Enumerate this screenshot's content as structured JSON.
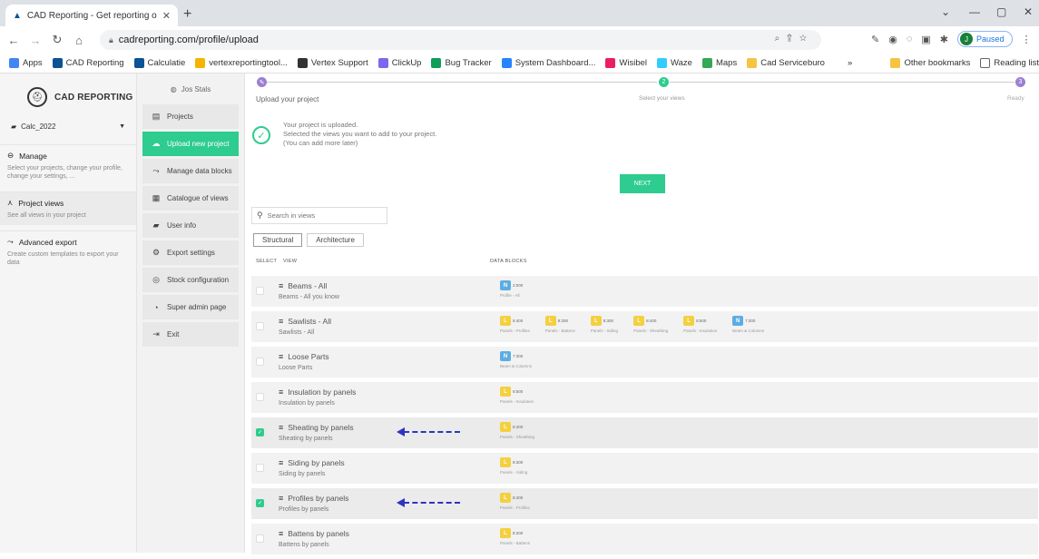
{
  "browser": {
    "tab_title": "CAD Reporting - Get reporting o",
    "url": "cadreporting.com/profile/upload",
    "paused_label": "Paused",
    "profile_initial": "J",
    "bookmarks": [
      {
        "label": "Apps",
        "color": "#4285f4"
      },
      {
        "label": "CAD Reporting",
        "color": "#0b5394"
      },
      {
        "label": "Calculatie",
        "color": "#0b5394"
      },
      {
        "label": "vertexreportingtool...",
        "color": "#f4b400"
      },
      {
        "label": "Vertex Support",
        "color": "#333333"
      },
      {
        "label": "ClickUp",
        "color": "#7b68ee"
      },
      {
        "label": "Bug Tracker",
        "color": "#0f9d58"
      },
      {
        "label": "System Dashboard...",
        "color": "#2684ff"
      },
      {
        "label": "Wisibel",
        "color": "#e91e63"
      },
      {
        "label": "Waze",
        "color": "#33ccff"
      },
      {
        "label": "Maps",
        "color": "#34a853"
      },
      {
        "label": "Cad Serviceburo",
        "color": "#f6c343"
      }
    ],
    "more_bookmarks": "»",
    "other_bookmarks": "Other bookmarks",
    "reading_list": "Reading list"
  },
  "app": {
    "logo": "CAD REPORTING",
    "project": "Calc_2022",
    "sections": [
      {
        "title": "Manage",
        "desc": "Select your projects, change your profile, change your settings, ..."
      },
      {
        "title": "Project views",
        "desc": "See all views in your project"
      },
      {
        "title": "Advanced export",
        "desc": "Create custom templates to export your data"
      }
    ],
    "user": "Jos Stals",
    "menu": [
      {
        "label": "Projects",
        "icon": "▤"
      },
      {
        "label": "Upload new project",
        "icon": "☁"
      },
      {
        "label": "Manage data blocks",
        "icon": "⤳"
      },
      {
        "label": "Catalogue of views",
        "icon": "▦"
      },
      {
        "label": "User info",
        "icon": "▰"
      },
      {
        "label": "Export settings",
        "icon": "⚙"
      },
      {
        "label": "Stock configuration",
        "icon": "◎"
      },
      {
        "label": "Super admin page",
        "icon": "◔"
      },
      {
        "label": "Exit",
        "icon": "⇥"
      }
    ]
  },
  "steps": [
    {
      "label": "Upload your project",
      "mark": "✎"
    },
    {
      "label": "Select your views",
      "mark": "2"
    },
    {
      "label": "Ready",
      "mark": "3"
    }
  ],
  "upload_message": {
    "line1": "Your project is uploaded.",
    "line2": "Selected the views you want to add to your project.",
    "line3": "(You can add more later)"
  },
  "next_label": "NEXT",
  "search_placeholder": "Search in views",
  "view_tabs": [
    "Structural",
    "Architecture"
  ],
  "columns": {
    "select": "SELECT",
    "view": "VIEW",
    "data_blocks": "DATA BLOCKS"
  },
  "colors": {
    "accent": "#2ecc8e",
    "arrow": "#2b35c4"
  },
  "views": [
    {
      "name": "Beams - All",
      "sub": "Beams - All you know",
      "checked": false,
      "blocks": [
        {
          "t": "b",
          "n": "2:000",
          "l": "Profile - All"
        }
      ]
    },
    {
      "name": "Sawlists - All",
      "sub": "Sawlists - All",
      "checked": false,
      "blocks": [
        {
          "t": "y",
          "n": "8:400",
          "l": "Panels - Profiles"
        },
        {
          "t": "y",
          "n": "8:200",
          "l": "Panels - Battens"
        },
        {
          "t": "y",
          "n": "8:300",
          "l": "Panels - Siding"
        },
        {
          "t": "y",
          "n": "8:400",
          "l": "Panels - Sheathing"
        },
        {
          "t": "y",
          "n": "8:500",
          "l": "Panels - Insulation"
        },
        {
          "t": "b",
          "n": "7:300",
          "l": "Beam & Columns"
        }
      ]
    },
    {
      "name": "Loose Parts",
      "sub": "Loose Parts",
      "checked": false,
      "blocks": [
        {
          "t": "b",
          "n": "7:300",
          "l": "Beam & Columns"
        }
      ]
    },
    {
      "name": "Insulation by panels",
      "sub": "Insulation by panels",
      "checked": false,
      "blocks": [
        {
          "t": "y",
          "n": "8:500",
          "l": "Panels - Insulation"
        }
      ]
    },
    {
      "name": "Sheating by panels",
      "sub": "Sheating by panels",
      "checked": true,
      "blocks": [
        {
          "t": "y",
          "n": "8:400",
          "l": "Panels - Sheathing"
        }
      ]
    },
    {
      "name": "Siding by panels",
      "sub": "Siding by panels",
      "checked": false,
      "blocks": [
        {
          "t": "y",
          "n": "8:300",
          "l": "Panels - Siding"
        }
      ]
    },
    {
      "name": "Profiles by panels",
      "sub": "Profiles by panels",
      "checked": true,
      "blocks": [
        {
          "t": "y",
          "n": "8:400",
          "l": "Panels - Profiles"
        }
      ]
    },
    {
      "name": "Battens by panels",
      "sub": "Battens by panels",
      "checked": false,
      "blocks": [
        {
          "t": "y",
          "n": "8:200",
          "l": "Panels - Battens"
        }
      ]
    }
  ]
}
